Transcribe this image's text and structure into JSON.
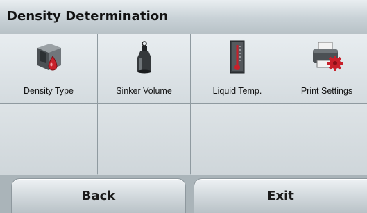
{
  "header": {
    "title": "Density Determination"
  },
  "menu": {
    "items": [
      {
        "label": "Density Type",
        "icon": "density-cube-icon"
      },
      {
        "label": "Sinker Volume",
        "icon": "sinker-weight-icon"
      },
      {
        "label": "Liquid Temp.",
        "icon": "thermometer-icon"
      },
      {
        "label": "Print Settings",
        "icon": "printer-gear-icon"
      }
    ]
  },
  "footer": {
    "back_label": "Back",
    "exit_label": "Exit"
  },
  "colors": {
    "accent_red": "#c8202a",
    "background": "#b9c2c7"
  }
}
